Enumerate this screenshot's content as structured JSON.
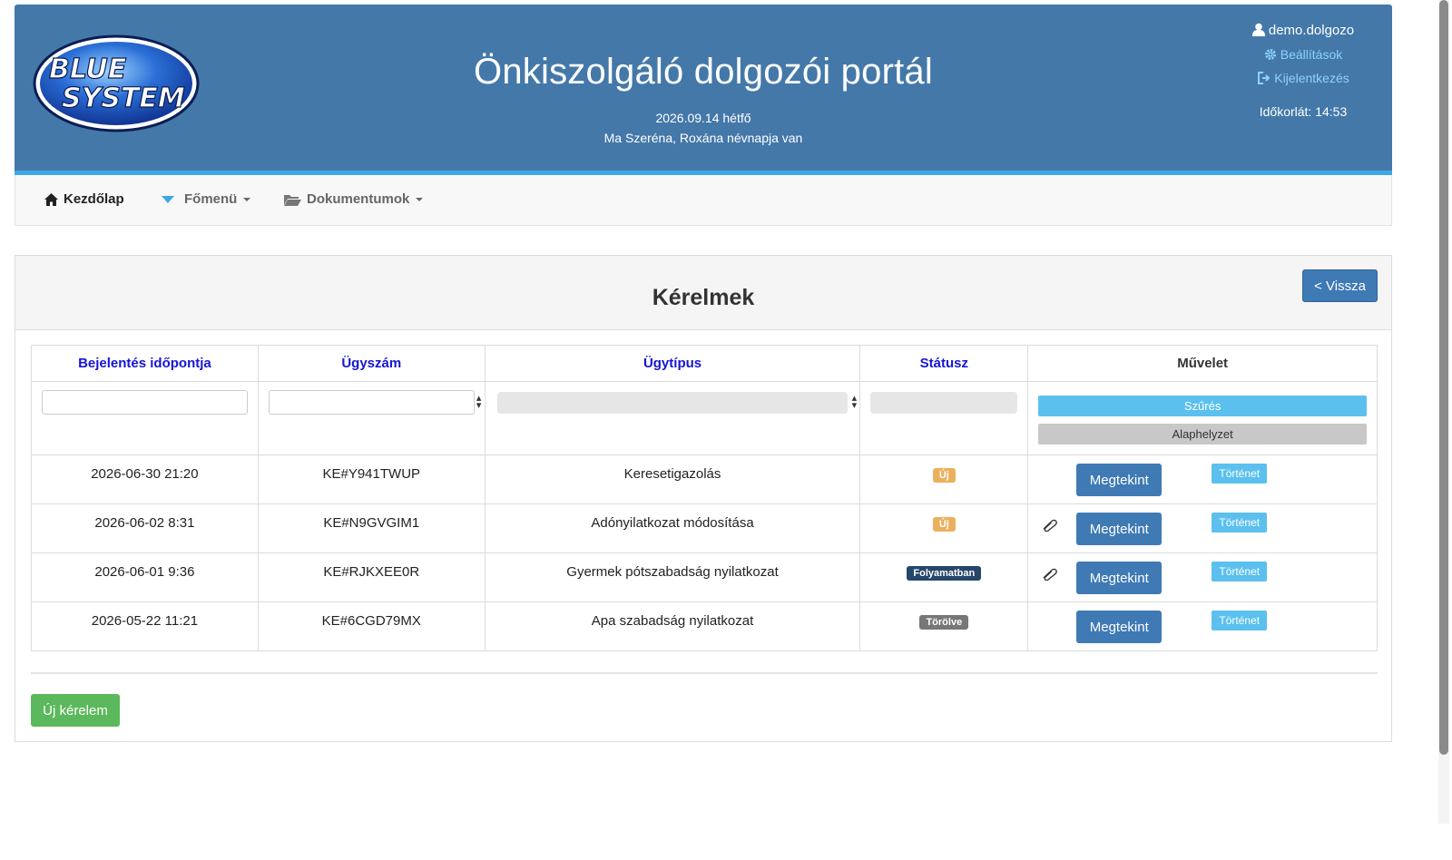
{
  "header": {
    "logo_text_line1": "BLUE",
    "logo_text_line2": "SYSTEM",
    "title": "Önkiszolgáló dolgozói portál",
    "date": "2026.09.14 hétfő",
    "nameday": "Ma Szeréna, Roxána névnapja van",
    "username": "demo.dolgozo",
    "settings_label": "Beállítások",
    "logout_label": "Kijelentkezés",
    "timeout": "Időkorlát: 14:53"
  },
  "nav": {
    "home": "Kezdőlap",
    "main_menu": "Főmenü",
    "documents": "Dokumentumok"
  },
  "panel": {
    "title": "Kérelmek",
    "back_label": "< Vissza"
  },
  "table": {
    "headers": {
      "date": "Bejelentés időpontja",
      "case_no": "Ügyszám",
      "type": "Ügytípus",
      "status": "Státusz",
      "action": "Művelet"
    },
    "filter_label": "Szűrés",
    "reset_label": "Alaphelyzet",
    "view_label": "Megtekint",
    "history_label": "Történet",
    "rows": [
      {
        "date": "2026-06-30 21:20",
        "case_no": "KE#Y941TWUP",
        "type": "Keresetigazolás",
        "status": "Új",
        "attachment": false
      },
      {
        "date": "2026-06-02 8:31",
        "case_no": "KE#N9GVGIM1",
        "type": "Adónyilatkozat módosítása",
        "status": "Új",
        "attachment": true
      },
      {
        "date": "2026-06-01 9:36",
        "case_no": "KE#RJKXEE0R",
        "type": "Gyermek pótszabadság nyilatkozat",
        "status": "Folyamatban",
        "attachment": true
      },
      {
        "date": "2026-05-22 11:21",
        "case_no": "KE#6CGD79MX",
        "type": "Apa szabadság nyilatkozat",
        "status": "Törölve",
        "attachment": false
      }
    ]
  },
  "new_request_label": "Új kérelem",
  "colors": {
    "header_bg": "#4478a9",
    "primary_button": "#3f7ab5",
    "info_button": "#5bc0ee",
    "success_button": "#5cb85c",
    "status_new": "#ebb05f",
    "status_in_progress": "#26466b",
    "status_deleted": "#777777"
  }
}
